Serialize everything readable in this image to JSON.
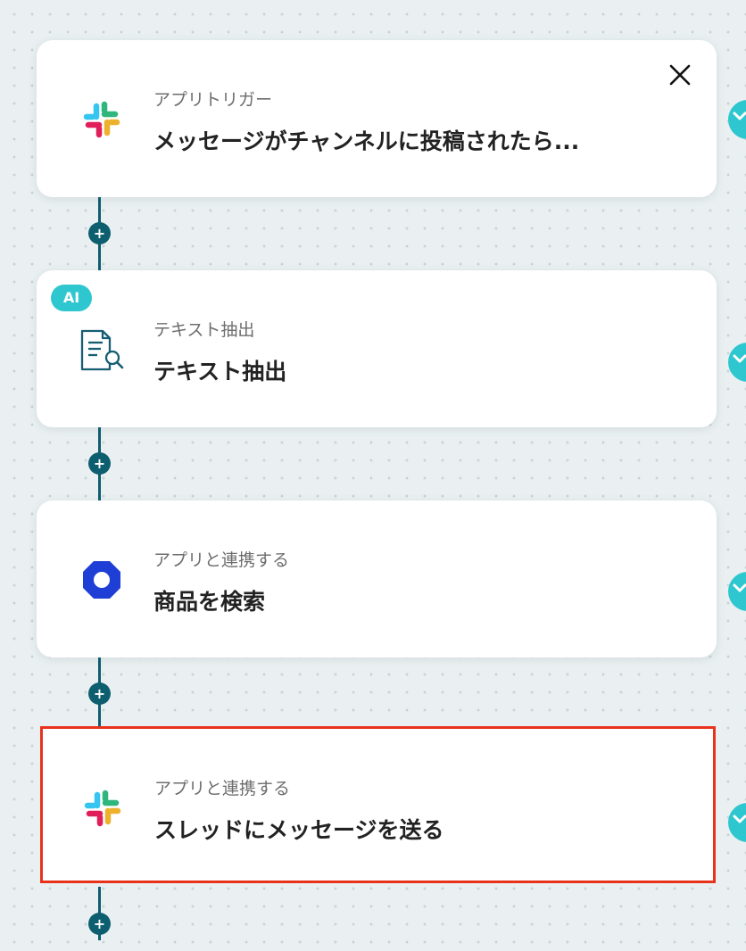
{
  "steps": [
    {
      "category": "アプリトリガー",
      "title": "メッセージがチャンネルに投稿されたら...",
      "icon": "slack-icon"
    },
    {
      "category": "テキスト抽出",
      "title": "テキスト抽出",
      "icon": "document-search-icon",
      "badge": "AI"
    },
    {
      "category": "アプリと連携する",
      "title": "商品を検索",
      "icon": "blue-octagon-ring-icon"
    },
    {
      "category": "アプリと連携する",
      "title": "スレッドにメッセージを送る",
      "icon": "slack-icon"
    }
  ],
  "add_step_label": "+",
  "colors": {
    "connector": "#0d5e6f",
    "badge": "#2fc7cf",
    "highlight": "#e8321b",
    "octagon": "#1f3ed6"
  }
}
